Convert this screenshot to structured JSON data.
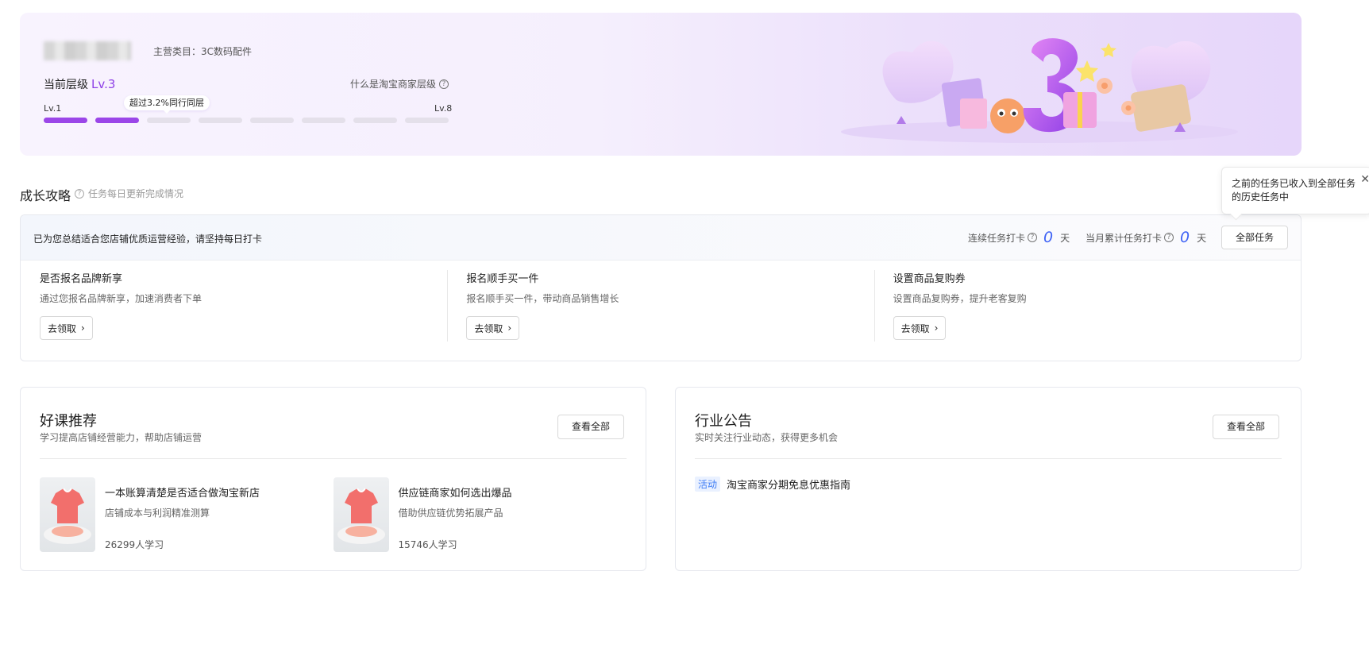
{
  "level_card": {
    "main_category": "主营类目：3C数码配件",
    "current_level_label": "当前层级",
    "current_level_value": "Lv.3",
    "level_help_label": "什么是淘宝商家层级",
    "level_start": "Lv.1",
    "level_end": "Lv.8",
    "progress_tip": "超过3.2%同行同层",
    "filled_segments": 2,
    "total_segments": 8,
    "accent_color": "#9b46e8"
  },
  "growth": {
    "title": "成长攻略",
    "subtitle": "任务每日更新完成情况",
    "tooltip": {
      "text": "之前的任务已收入到全部任务的历史任务中",
      "close_icon": "close-icon"
    },
    "header_message": "已为您总结适合您店铺优质运营经验，请坚持每日打卡",
    "streak_label": "连续任务打卡",
    "streak_value": "0",
    "month_label": "当月累计任务打卡",
    "month_value": "0",
    "day_unit": "天",
    "all_tasks_label": "全部任务",
    "tasks": [
      {
        "title": "是否报名品牌新享",
        "desc": "通过您报名品牌新享，加速消费者下单",
        "button": "去领取"
      },
      {
        "title": "报名顺手买一件",
        "desc": "报名顺手买一件，带动商品销售增长",
        "button": "去领取"
      },
      {
        "title": "设置商品复购券",
        "desc": "设置商品复购券，提升老客复购",
        "button": "去领取"
      }
    ]
  },
  "courses": {
    "title": "好课推荐",
    "subtitle": "学习提高店铺经营能力，帮助店铺运营",
    "view_all": "查看全部",
    "items": [
      {
        "title": "一本账算清楚是否适合做淘宝新店",
        "desc": "店铺成本与利润精准测算",
        "count": "26299人学习"
      },
      {
        "title": "供应链商家如何选出爆品",
        "desc": "借助供应链优势拓展产品",
        "count": "15746人学习"
      }
    ]
  },
  "notices": {
    "title": "行业公告",
    "subtitle": "实时关注行业动态，获得更多机会",
    "view_all": "查看全部",
    "items": [
      {
        "tag": "活动",
        "text": "淘宝商家分期免息优惠指南"
      }
    ]
  }
}
